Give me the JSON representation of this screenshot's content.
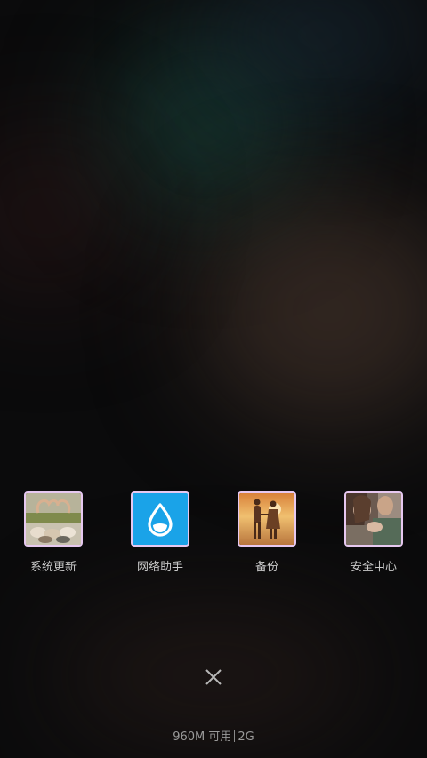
{
  "recent_apps": [
    {
      "label": "系统更新",
      "icon": "heart-hands-photo-icon"
    },
    {
      "label": "网络助手",
      "icon": "water-drop-icon",
      "tile_color": "#1aa3e8"
    },
    {
      "label": "备份",
      "icon": "couple-sunset-photo-icon"
    },
    {
      "label": "安全中心",
      "icon": "couple-embrace-photo-icon"
    }
  ],
  "close_icon": "close-icon",
  "memory": {
    "available": "960M 可用",
    "total": "2G"
  }
}
